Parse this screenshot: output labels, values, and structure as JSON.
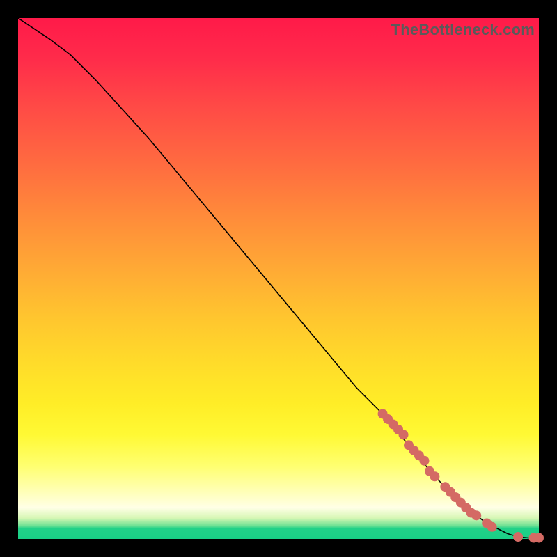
{
  "watermark": "TheBottleneck.com",
  "colors": {
    "background": "#000000",
    "curve": "#000000",
    "dot": "#d46a64",
    "gradient_top": "#ff1a49",
    "gradient_bottom": "#19cf86"
  },
  "chart_data": {
    "type": "line",
    "title": "",
    "xlabel": "",
    "ylabel": "",
    "xlim": [
      0,
      100
    ],
    "ylim": [
      0,
      100
    ],
    "grid": false,
    "legend": false,
    "series": [
      {
        "name": "curve",
        "x": [
          0,
          3,
          6,
          10,
          15,
          20,
          25,
          30,
          35,
          40,
          45,
          50,
          55,
          60,
          65,
          70,
          75,
          80,
          83,
          86,
          90,
          94,
          96,
          98,
          100
        ],
        "y": [
          100,
          98,
          96,
          93,
          88,
          82.5,
          77,
          71,
          65,
          59,
          53,
          47,
          41,
          35,
          29,
          24,
          18,
          12,
          9,
          6,
          3,
          1,
          0.4,
          0.2,
          0.2
        ]
      }
    ],
    "highlighted_points": {
      "name": "dots",
      "x": [
        70,
        71,
        72,
        73,
        74,
        75,
        76,
        77,
        78,
        79,
        80,
        82,
        83,
        84,
        85,
        86,
        87,
        88,
        90,
        91,
        96,
        99,
        100
      ],
      "y": [
        24,
        23,
        22,
        21,
        20,
        18,
        17,
        16,
        15,
        13,
        12,
        10,
        9,
        8,
        7,
        6,
        5,
        4.5,
        3,
        2.3,
        0.4,
        0.2,
        0.2
      ]
    }
  }
}
